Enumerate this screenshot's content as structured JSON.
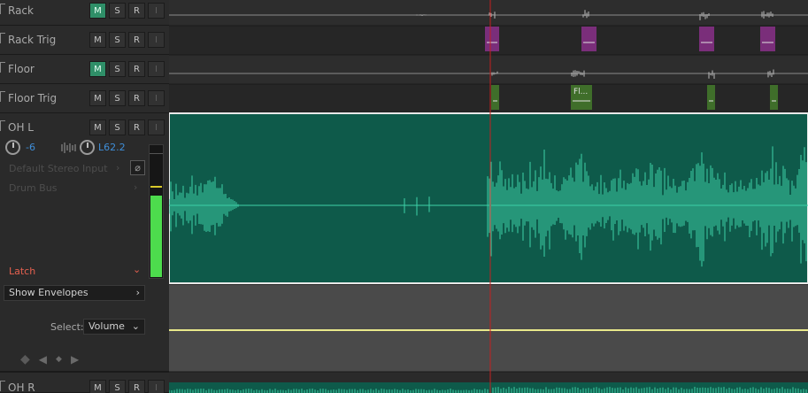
{
  "tracks": [
    {
      "name": "Rack",
      "mute_on": true,
      "buttons": [
        "M",
        "S",
        "R",
        "I"
      ]
    },
    {
      "name": "Rack Trig",
      "mute_on": false,
      "buttons": [
        "M",
        "S",
        "R",
        "I"
      ]
    },
    {
      "name": "Floor",
      "mute_on": true,
      "buttons": [
        "M",
        "S",
        "R",
        "I"
      ]
    },
    {
      "name": "Floor Trig",
      "mute_on": false,
      "buttons": [
        "M",
        "S",
        "R",
        "I"
      ]
    },
    {
      "name": "OH L",
      "mute_on": false,
      "buttons": [
        "M",
        "S",
        "R",
        "I"
      ]
    },
    {
      "name": "OH R",
      "mute_on": false,
      "buttons": [
        "M",
        "S",
        "R",
        "I"
      ]
    }
  ],
  "ohl": {
    "volume": "-6",
    "pan": "L62.2",
    "input": "Default Stereo Input",
    "output": "Drum Bus",
    "null_symbol": "⌀",
    "automation_mode": "Latch",
    "show_envelopes": "Show Envelopes",
    "select_label": "Select:",
    "select_value": "Volume",
    "meter_level": 0.61,
    "meter_peak": 0.68
  },
  "clips": {
    "rack_trig_label": "Fl...",
    "floor_trig_label": "Fl..."
  },
  "colors": {
    "mute_on": "#2f8f68",
    "waveform": "#3dd1a8",
    "clip_bg": "#0e5a4a",
    "envelope": "#e8e88a",
    "playhead": "#c42020",
    "rack_trig_clip": "#7a2e7a",
    "floor_trig_clip": "#3f6e2a",
    "latch": "#e5604f",
    "value_blue": "#3f8ed8"
  },
  "icons": {
    "chevron_right": "›",
    "chevron_down": "⌄",
    "eraser": "◆",
    "prev_keyframe": "◀",
    "add_keyframe": "◆",
    "next_keyframe": "▶"
  }
}
